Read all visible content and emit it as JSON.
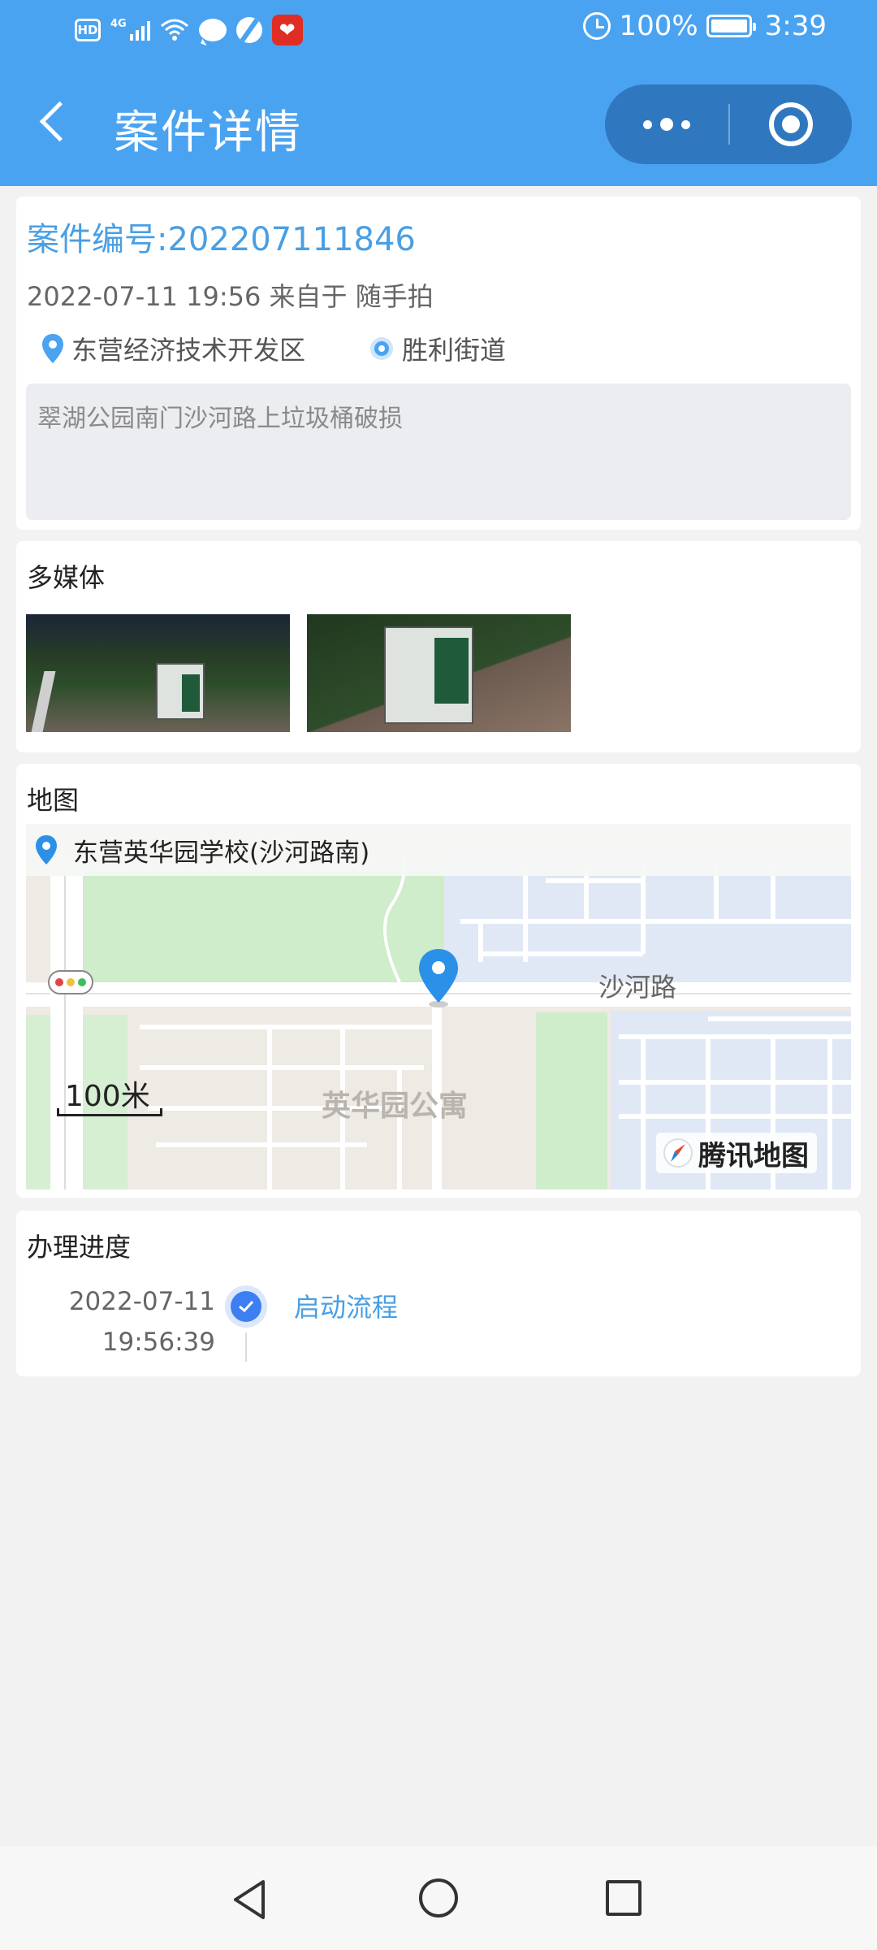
{
  "status_bar": {
    "hd": "HD",
    "network": "4G",
    "app_badge": "❤",
    "battery": "100%",
    "time": "3:39"
  },
  "header": {
    "title": "案件详情"
  },
  "case": {
    "number_label": "案件编号:202207111846",
    "meta": "2022-07-11 19:56 来自于 随手拍",
    "district": "东营经济技术开发区",
    "street": "胜利街道",
    "description": "翠湖公园南门沙河路上垃圾桶破损"
  },
  "media": {
    "title": "多媒体",
    "thumbnails": 2
  },
  "map": {
    "title": "地图",
    "place_name": "东营英华园学校(沙河路南)",
    "road_label": "沙河路",
    "area_label": "英华园公寓",
    "scale": "100米",
    "provider": "腾讯地图"
  },
  "progress": {
    "title": "办理进度",
    "entries": [
      {
        "date": "2022-07-11",
        "time": "19:56:39",
        "step": "启动流程"
      }
    ]
  },
  "colors": {
    "header": "#4aa3f1",
    "accent": "#4a9fe3",
    "capsule": "#2f78bf",
    "check": "#3d7ef2"
  }
}
